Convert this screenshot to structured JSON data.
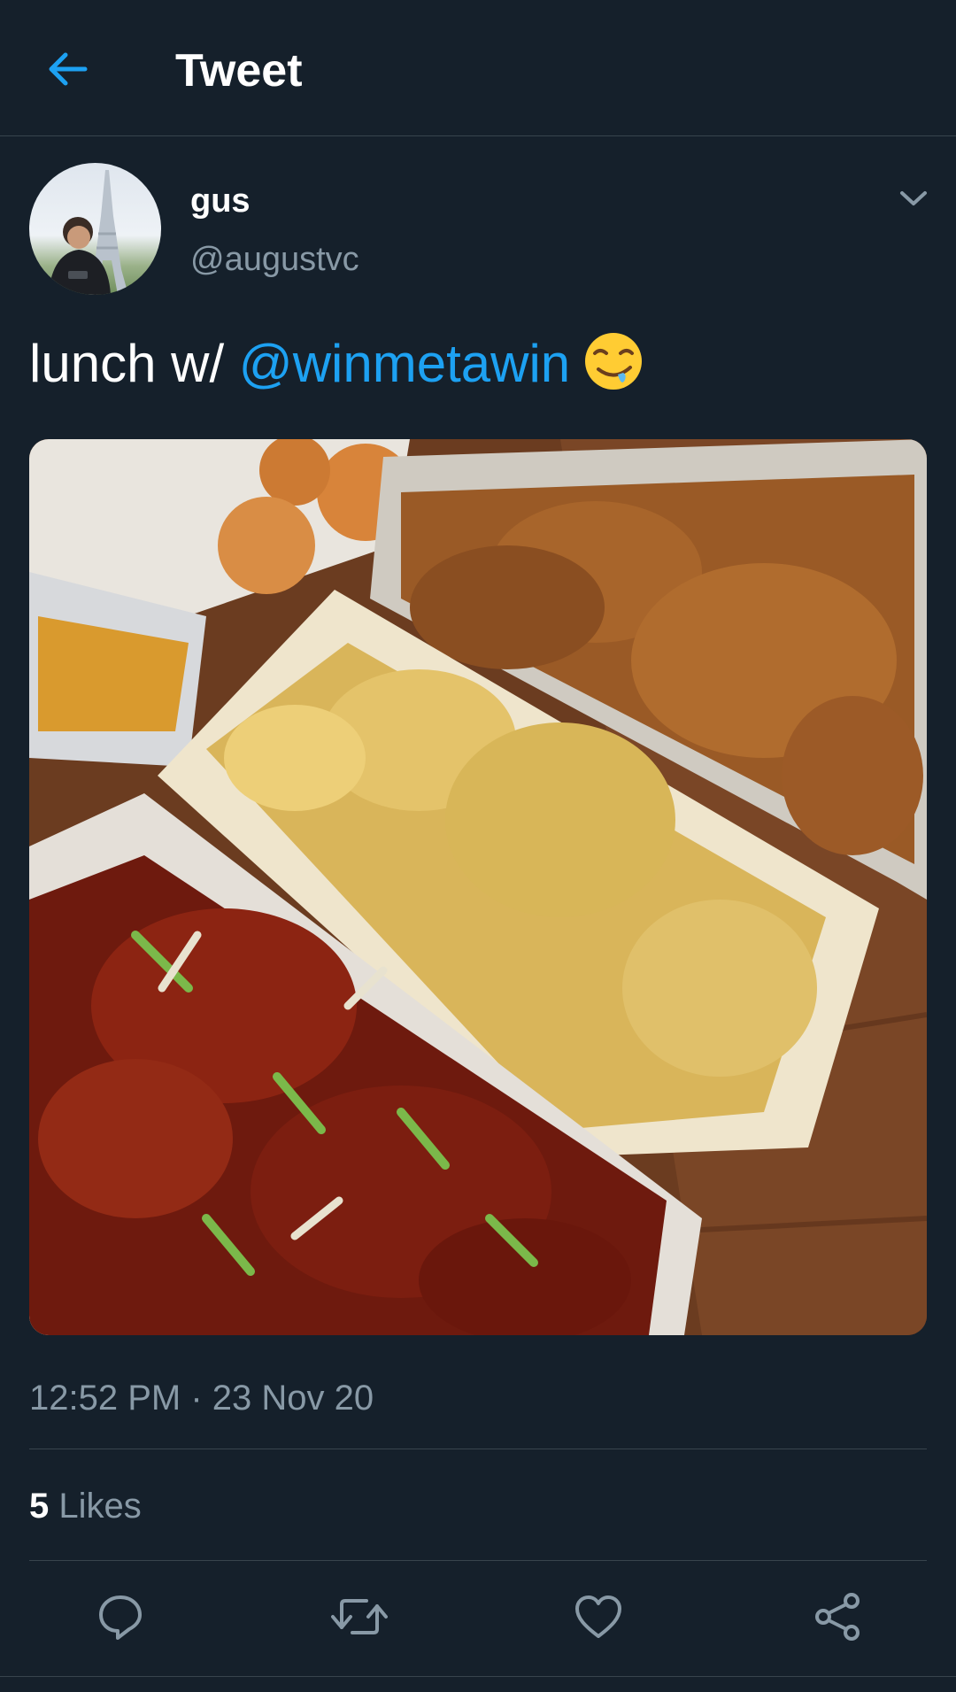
{
  "header": {
    "title": "Tweet",
    "back_icon": "arrow-left-icon"
  },
  "author": {
    "display_name": "gus",
    "handle": "@augustvc",
    "avatar_icon": "avatar-photo"
  },
  "tweet": {
    "text_prefix": "lunch w/ ",
    "mention": "@winmetawin",
    "emoji_icon": "drooling-face-emoji",
    "media_icon": "fried-chicken-photo"
  },
  "meta": {
    "timestamp": "12:52 PM · 23 Nov 20"
  },
  "stats": {
    "likes_count": "5",
    "likes_label": "Likes"
  },
  "actions": {
    "reply_icon": "reply-icon",
    "retweet_icon": "retweet-icon",
    "like_icon": "heart-icon",
    "share_icon": "share-icon"
  },
  "colors": {
    "background": "#15202b",
    "accent": "#1da1f2",
    "secondary_text": "#8899a6",
    "divider": "#38444d"
  }
}
